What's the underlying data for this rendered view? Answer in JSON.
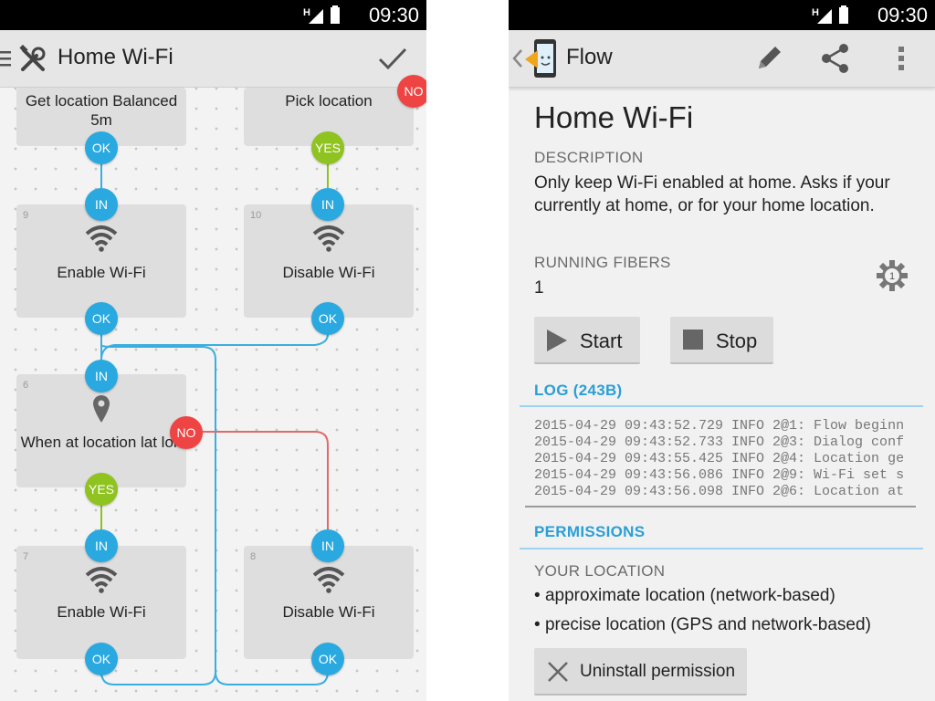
{
  "status_bar": {
    "time": "09:30",
    "network": "H"
  },
  "editor": {
    "title": "Home Wi-Fi",
    "menu_icon": "hamburger-icon",
    "tools_icon": "tools-icon",
    "confirm_icon": "checkmark-icon",
    "nodes": [
      {
        "id": "get-location",
        "number": "",
        "label": "Get location Balanced 5m"
      },
      {
        "id": "pick-location",
        "number": "",
        "label": "Pick location"
      },
      {
        "id": "enable-wifi-9",
        "number": "9",
        "label": "Enable Wi-Fi",
        "icon": "wifi-icon"
      },
      {
        "id": "disable-wifi-10",
        "number": "10",
        "label": "Disable Wi-Fi",
        "icon": "wifi-icon"
      },
      {
        "id": "when-at-location",
        "number": "6",
        "label": "When at location lat lon",
        "icon": "location-pin-icon"
      },
      {
        "id": "enable-wifi-7",
        "number": "7",
        "label": "Enable Wi-Fi",
        "icon": "wifi-icon"
      },
      {
        "id": "disable-wifi-8",
        "number": "8",
        "label": "Disable Wi-Fi",
        "icon": "wifi-icon"
      }
    ],
    "ports": {
      "ok": "OK",
      "in": "IN",
      "yes": "YES",
      "no": "NO"
    },
    "colors": {
      "port_blue": "#29a9e0",
      "port_green": "#8fc31f",
      "port_red": "#ee4444",
      "wire_blue": "#3aaee0",
      "wire_red": "#e06a6a"
    }
  },
  "details": {
    "app_name": "Flow",
    "app_icon": "flow-app-icon",
    "back_icon": "chevron-left-icon",
    "edit_icon": "pencil-icon",
    "share_icon": "share-icon",
    "overflow_icon": "overflow-menu-icon",
    "title": "Home Wi-Fi",
    "description_heading": "DESCRIPTION",
    "description": "Only keep Wi-Fi enabled at home. Asks if your currently at home, or for your home location.",
    "running_fibers_heading": "RUNNING FIBERS",
    "running_fibers": "1",
    "fiber_settings_icon": "gear-icon",
    "fiber_settings_badge": "1",
    "start_label": "Start",
    "start_icon": "play-icon",
    "stop_label": "Stop",
    "stop_icon": "stop-icon",
    "log_heading": "LOG (243B)",
    "log_lines": [
      "2015-04-29 09:43:52.729 INFO 2@1: Flow beginn",
      "2015-04-29 09:43:52.733 INFO 2@3: Dialog conf",
      "2015-04-29 09:43:55.425 INFO 2@4: Location ge",
      "2015-04-29 09:43:56.086 INFO 2@9: Wi-Fi set s",
      "2015-04-29 09:43:56.098 INFO 2@6: Location at"
    ],
    "permissions_heading": "PERMISSIONS",
    "permission_group": "YOUR LOCATION",
    "permissions": [
      "approximate location (network-based)",
      "precise location (GPS and network-based)"
    ],
    "uninstall_label": "Uninstall permission",
    "uninstall_icon": "close-icon",
    "accent_color": "#2a9fd6"
  }
}
